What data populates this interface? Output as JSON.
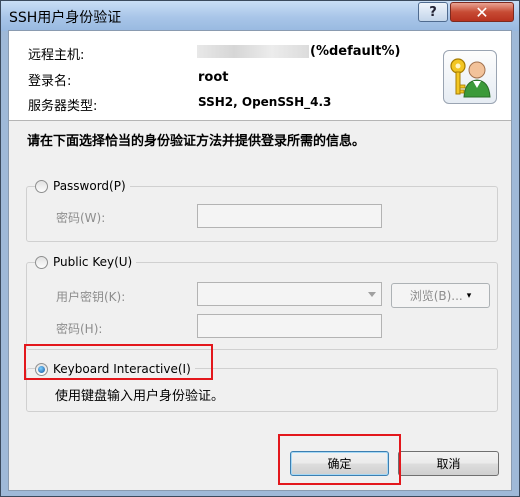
{
  "window": {
    "title": "SSH用户身份验证",
    "help_label": "?",
    "close_label": "✕"
  },
  "info": {
    "remote_host_label": "远程主机:",
    "remote_host_value": "(%default%)",
    "login_label": "登录名:",
    "login_value": "root",
    "server_type_label": "服务器类型:",
    "server_type_value": "SSH2, OpenSSH_4.3",
    "icon": "key-user-icon"
  },
  "instruction": "请在下面选择恰当的身份验证方法并提供登录所需的信息。",
  "password": {
    "label": "Password(P)",
    "field_label": "密码(W):",
    "value": ""
  },
  "public_key": {
    "label": "Public Key(U)",
    "user_key_label": "用户密钥(K):",
    "browse_label": "浏览(B)...",
    "passphrase_label": "密码(H):",
    "user_key_value": "",
    "passphrase_value": ""
  },
  "keyboard": {
    "label": "Keyboard Interactive(I)",
    "description": "使用键盘输入用户身份验证。",
    "selected": true
  },
  "buttons": {
    "ok": "确定",
    "cancel": "取消"
  },
  "colors": {
    "highlight": "#e3171c",
    "title_bar": "#a8c5e8",
    "close": "#c74b34"
  }
}
